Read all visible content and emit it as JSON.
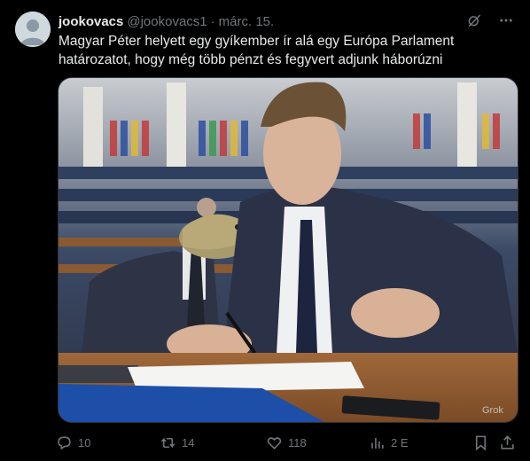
{
  "author": {
    "name": "jookovacs",
    "handle": "@jookovacs1",
    "separator": "·",
    "date": "márc. 15."
  },
  "tweet_text": "Magyar Péter helyett egy gyíkember ír alá egy Európa Parlament határozatot, hogy még több pénzt és fegyvert adjunk háborúzni",
  "media": {
    "watermark": "Grok"
  },
  "actions": {
    "replies": "10",
    "retweets": "14",
    "likes": "118",
    "views": "2 E"
  },
  "icons": [
    "grok-icon",
    "more-icon",
    "reply-icon",
    "retweet-icon",
    "like-icon",
    "views-icon",
    "bookmark-icon",
    "share-icon"
  ]
}
